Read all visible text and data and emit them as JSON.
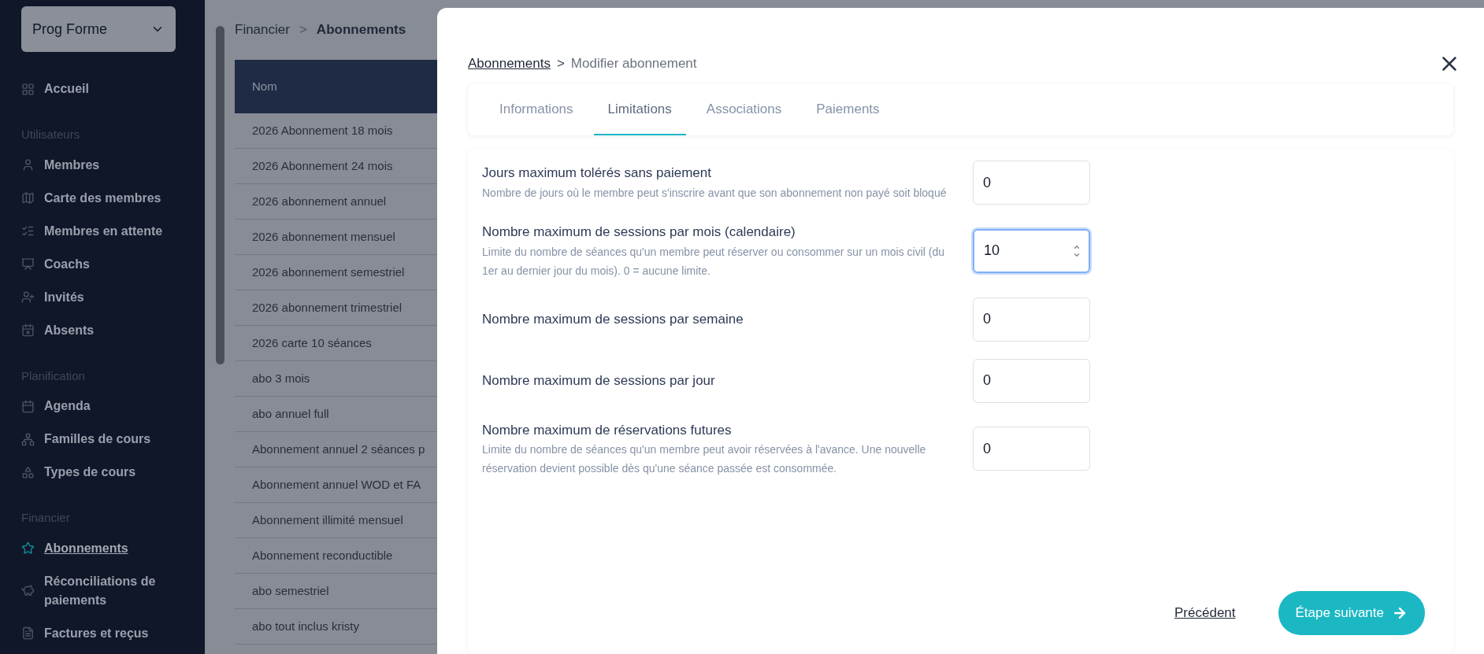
{
  "sidebar": {
    "org_selector": {
      "value": "Prog Forme"
    },
    "sections": [
      {
        "items": [
          {
            "label": "Accueil",
            "selected": false
          }
        ]
      },
      {
        "title": "Utilisateurs",
        "items": [
          {
            "label": "Membres",
            "selected": false
          },
          {
            "label": "Carte des membres",
            "selected": false
          },
          {
            "label": "Membres en attente",
            "selected": false
          },
          {
            "label": "Coachs",
            "selected": false
          },
          {
            "label": "Invités",
            "selected": false
          },
          {
            "label": "Absents",
            "selected": false
          }
        ]
      },
      {
        "title": "Planification",
        "items": [
          {
            "label": "Agenda",
            "selected": false
          },
          {
            "label": "Familles de cours",
            "selected": false
          },
          {
            "label": "Types de cours",
            "selected": false
          }
        ]
      },
      {
        "title": "Financier",
        "items": [
          {
            "label": "Abonnements",
            "selected": true
          },
          {
            "label": "Réconciliations de paiements",
            "selected": false
          },
          {
            "label": "Factures et reçus",
            "selected": false
          }
        ]
      }
    ]
  },
  "page": {
    "breadcrumb": [
      "Financier",
      "Abonnements"
    ],
    "breadcrumb_separator": ">",
    "table": {
      "columns": [
        "Nom"
      ],
      "rows": [
        "2026 Abonnement 18 mois",
        "2026 Abonnement 24 mois",
        "2026 abonnement annuel",
        "2026 abonnement mensuel",
        "2026 abonnement semestriel",
        "2026 abonnement trimestriel",
        "2026 carte 10 séances",
        "abo 3 mois",
        "abo annuel full",
        "Abonnement annuel 2 séances p",
        "Abonnement annuel WOD et FA",
        "Abonnement illimité mensuel",
        "Abonnement reconductible",
        "abo semestriel",
        "abo tout inclus kristy"
      ]
    }
  },
  "modal": {
    "breadcrumb": {
      "link": "Abonnements",
      "separator": ">",
      "current": "Modifier abonnement"
    },
    "tabs": [
      {
        "label": "Informations",
        "selected": false
      },
      {
        "label": "Limitations",
        "selected": true
      },
      {
        "label": "Associations",
        "selected": false
      },
      {
        "label": "Paiements",
        "selected": false
      }
    ],
    "fields": [
      {
        "label": "Jours maximum tolérés sans paiement",
        "help": "Nombre de jours où le membre peut s'inscrire avant que son abonnement non payé soit bloqué",
        "value": "0",
        "focused": false
      },
      {
        "label": "Nombre maximum de sessions par mois (calendaire)",
        "help": "Limite du nombre de séances qu'un membre peut réserver ou consommer sur un mois civil (du 1er au dernier jour du mois). 0 = aucune limite.",
        "value": "10",
        "focused": true
      },
      {
        "label": "Nombre maximum de sessions par semaine",
        "value": "0",
        "focused": false
      },
      {
        "label": "Nombre maximum de sessions par jour",
        "value": "0",
        "focused": false
      },
      {
        "label": "Nombre maximum de réservations futures",
        "help": "Limite du nombre de séances qu'un membre peut avoir réservées à l'avance. Une nouvelle réservation devient possible dès qu'une séance passée est consommée.",
        "value": "0",
        "focused": false
      }
    ],
    "footer": {
      "back": "Précédent",
      "next": "Étape suivante"
    }
  }
}
